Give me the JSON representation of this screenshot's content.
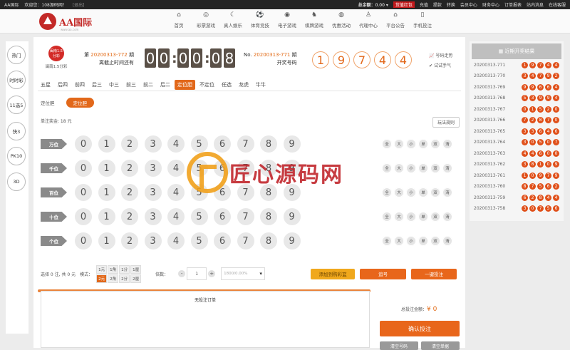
{
  "topbar": {
    "site_name": "AA国际",
    "welcome": "欢迎您：108源码网！",
    "logout": "[退出]",
    "balance_label": "总余额：",
    "balance_value": "0.00",
    "recharge_alert": "货值红包",
    "links": [
      "充值",
      "提款",
      "转换",
      "会员中心",
      "财务中心",
      "订单报表",
      "站内消息",
      "在线客服"
    ]
  },
  "header": {
    "logo_title": "AA国际",
    "logo_sub": "www.aa.com",
    "nav": [
      {
        "label": "首页",
        "icon": "home-icon"
      },
      {
        "label": "彩票游戏",
        "icon": "lottery-icon"
      },
      {
        "label": "真人娱乐",
        "icon": "live-icon"
      },
      {
        "label": "体育竞技",
        "icon": "ball-icon"
      },
      {
        "label": "电子游戏",
        "icon": "slot-icon"
      },
      {
        "label": "棋牌游戏",
        "icon": "chess-icon"
      },
      {
        "label": "优惠活动",
        "icon": "gift-icon"
      },
      {
        "label": "代理中心",
        "icon": "agent-icon"
      },
      {
        "label": "平台公告",
        "icon": "notice-icon"
      },
      {
        "label": "手机投注",
        "icon": "phone-icon"
      }
    ]
  },
  "sidebar": [
    "热门",
    "时时彩",
    "11选5",
    "快3",
    "PK10",
    "3D"
  ],
  "game": {
    "name": "闽南1.5分彩",
    "logo_text": "闽南1.5分彩",
    "issue_prefix": "第",
    "issue": "20200313-772",
    "issue_suffix": "期",
    "deadline_label": "离截止时间还有",
    "timer": [
      "0",
      "0",
      "0",
      "0",
      "0",
      "8"
    ],
    "last_prefix": "No.",
    "last_issue": "20200313-771",
    "last_suffix": "期",
    "last_label": "开奖号码",
    "last_numbers": [
      "1",
      "9",
      "7",
      "4",
      "4"
    ],
    "trend_label": "号码走势",
    "trial_label": "试试手气"
  },
  "tabs": [
    "五星",
    "后四",
    "前四",
    "后三",
    "中三",
    "前三",
    "前二",
    "后二",
    "定位胆",
    "不定位",
    "任选",
    "龙虎",
    "牛牛"
  ],
  "active_tab": "定位胆",
  "subtab_label": "定位胆",
  "subtab_active": "定位胆",
  "prize_text": "单注奖金: 18 元",
  "rules_label": "玩法规则",
  "positions": [
    "万位",
    "千位",
    "百位",
    "十位",
    "个位"
  ],
  "numbers": [
    "0",
    "1",
    "2",
    "3",
    "4",
    "5",
    "6",
    "7",
    "8",
    "9"
  ],
  "quick_picks": [
    "全",
    "大",
    "小",
    "单",
    "双",
    "清"
  ],
  "betbar": {
    "summary": "选择 0 注, 共 0 元",
    "mode_label": "模式：",
    "units": [
      "1元",
      "1角",
      "1分",
      "1厘",
      "2元",
      "2角",
      "2分",
      "2厘"
    ],
    "selected_unit": "2元",
    "multiplier_label": "倍数：",
    "multiplier_value": "1",
    "odds_value": "1800/0.00%",
    "add_to_cart": "添加到购彩篮",
    "chase": "追号",
    "quick_bet": "一键投注"
  },
  "order": {
    "empty_text": "无投注订单",
    "total_label": "总投注金额：",
    "total_value": "¥ 0",
    "confirm": "确认投注",
    "buttons": [
      "清空号码",
      "清空单据"
    ]
  },
  "history": {
    "title": "近期开奖结果",
    "rows": [
      {
        "issue": "20200313-771",
        "nums": [
          "1",
          "9",
          "7",
          "4",
          "4"
        ]
      },
      {
        "issue": "20200313-770",
        "nums": [
          "3",
          "4",
          "7",
          "9",
          "2"
        ]
      },
      {
        "issue": "20200313-769",
        "nums": [
          "9",
          "9",
          "6",
          "6",
          "4"
        ]
      },
      {
        "issue": "20200313-768",
        "nums": [
          "5",
          "3",
          "9",
          "9",
          "4"
        ]
      },
      {
        "issue": "20200313-767",
        "nums": [
          "0",
          "1",
          "5",
          "2",
          "0"
        ]
      },
      {
        "issue": "20200313-766",
        "nums": [
          "7",
          "2",
          "8",
          "7",
          "0"
        ]
      },
      {
        "issue": "20200313-765",
        "nums": [
          "3",
          "3",
          "6",
          "4",
          "6"
        ]
      },
      {
        "issue": "20200313-764",
        "nums": [
          "3",
          "0",
          "5",
          "0",
          "7"
        ]
      },
      {
        "issue": "20200313-763",
        "nums": [
          "4",
          "4",
          "6",
          "0",
          "0"
        ]
      },
      {
        "issue": "20200313-762",
        "nums": [
          "3",
          "8",
          "1",
          "0",
          "9"
        ]
      },
      {
        "issue": "20200313-761",
        "nums": [
          "1",
          "0",
          "9",
          "7",
          "9"
        ]
      },
      {
        "issue": "20200313-760",
        "nums": [
          "8",
          "7",
          "5",
          "6",
          "2"
        ]
      },
      {
        "issue": "20200313-759",
        "nums": [
          "6",
          "2",
          "8",
          "4",
          "4"
        ]
      },
      {
        "issue": "20200313-758",
        "nums": [
          "3",
          "0",
          "7",
          "5",
          "6"
        ]
      }
    ]
  },
  "watermark": "匠心源码网",
  "colors": {
    "accent": "#e2681a",
    "brand": "#c32927",
    "topbar": "#242424"
  }
}
